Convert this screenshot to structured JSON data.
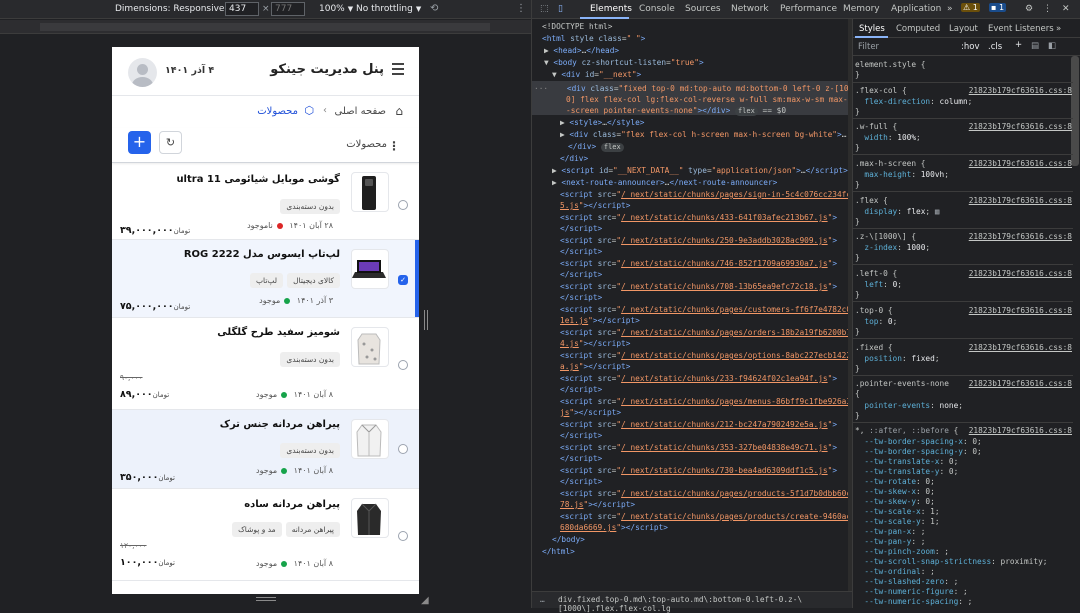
{
  "device_toolbar": {
    "dimensions_label": "Dimensions: Responsive",
    "width_value": "437",
    "height_placeholder": "777",
    "times": "×",
    "zoom": "100%",
    "throttle": "No throttling"
  },
  "page": {
    "brand": "پنل مدیریت جینکو",
    "date": "۴ آذر ۱۴۰۱",
    "breadcrumb": {
      "home": "صفحه اصلی",
      "current": "محصولات",
      "sep": "›"
    },
    "title": "محصولات",
    "add_label": "+",
    "refresh_label": "↻",
    "products": [
      {
        "name": "گوشی موبایل شیائومی 11 ultra",
        "tags": [
          "بدون دسته‌بندی"
        ],
        "date": "۲۸ آبان ۱۴۰۱",
        "status": "ناموجود",
        "status_color": "#dc2626",
        "old_price": "",
        "price": "۳۹,۰۰۰,۰۰۰",
        "unit": "تومان",
        "checked": false
      },
      {
        "name": "لپ‌تاپ ایسوس مدل ROG 2222",
        "tags": [
          "کالای دیجیتال",
          "لپ‌تاپ"
        ],
        "date": "۳ آذر ۱۴۰۱",
        "status": "موجود",
        "status_color": "#16a34a",
        "old_price": "",
        "price": "۷۵,۰۰۰,۰۰۰",
        "unit": "تومان",
        "checked": true
      },
      {
        "name": "شومیز سفید طرح گلگلی",
        "tags": [
          "بدون دسته‌بندی"
        ],
        "date": "۸ آبان ۱۴۰۱",
        "status": "موجود",
        "status_color": "#16a34a",
        "old_price": "۹۰,۰۰۰",
        "price": "۸۹,۰۰۰",
        "unit": "تومان",
        "checked": false
      },
      {
        "name": "پیراهن مردانه جنس ترک",
        "tags": [
          "بدون دسته‌بندی"
        ],
        "date": "۸ آبان ۱۴۰۱",
        "status": "موجود",
        "status_color": "#16a34a",
        "old_price": "",
        "price": "۳۵۰,۰۰۰",
        "unit": "تومان",
        "checked": false
      },
      {
        "name": "پیراهن مردانه ساده",
        "tags": [
          "پیراهن مردانه",
          "مد و پوشاک"
        ],
        "date": "۸ آبان ۱۴۰۱",
        "status": "موجود",
        "status_color": "#16a34a",
        "old_price": "۱۲۰,۰۰۰",
        "price": "۱۰۰,۰۰۰",
        "unit": "تومان",
        "checked": false
      }
    ]
  },
  "devtools": {
    "tabs": [
      "Elements",
      "Console",
      "Sources",
      "Network",
      "Performance",
      "Memory",
      "Application",
      "»"
    ],
    "warn_count": "1",
    "info_count": "1",
    "styles_tabs": [
      "Styles",
      "Computed",
      "Layout",
      "Event Listeners",
      "»"
    ],
    "filter_placeholder": "Filter",
    "filter_hov": ":hov",
    "filter_cls": ".cls",
    "breadcrumb": "div.fixed.top-0.md\\:top-auto.md\\:bottom-0.left-0.z-\\[1000\\].flex.flex-col.lg"
  }
}
